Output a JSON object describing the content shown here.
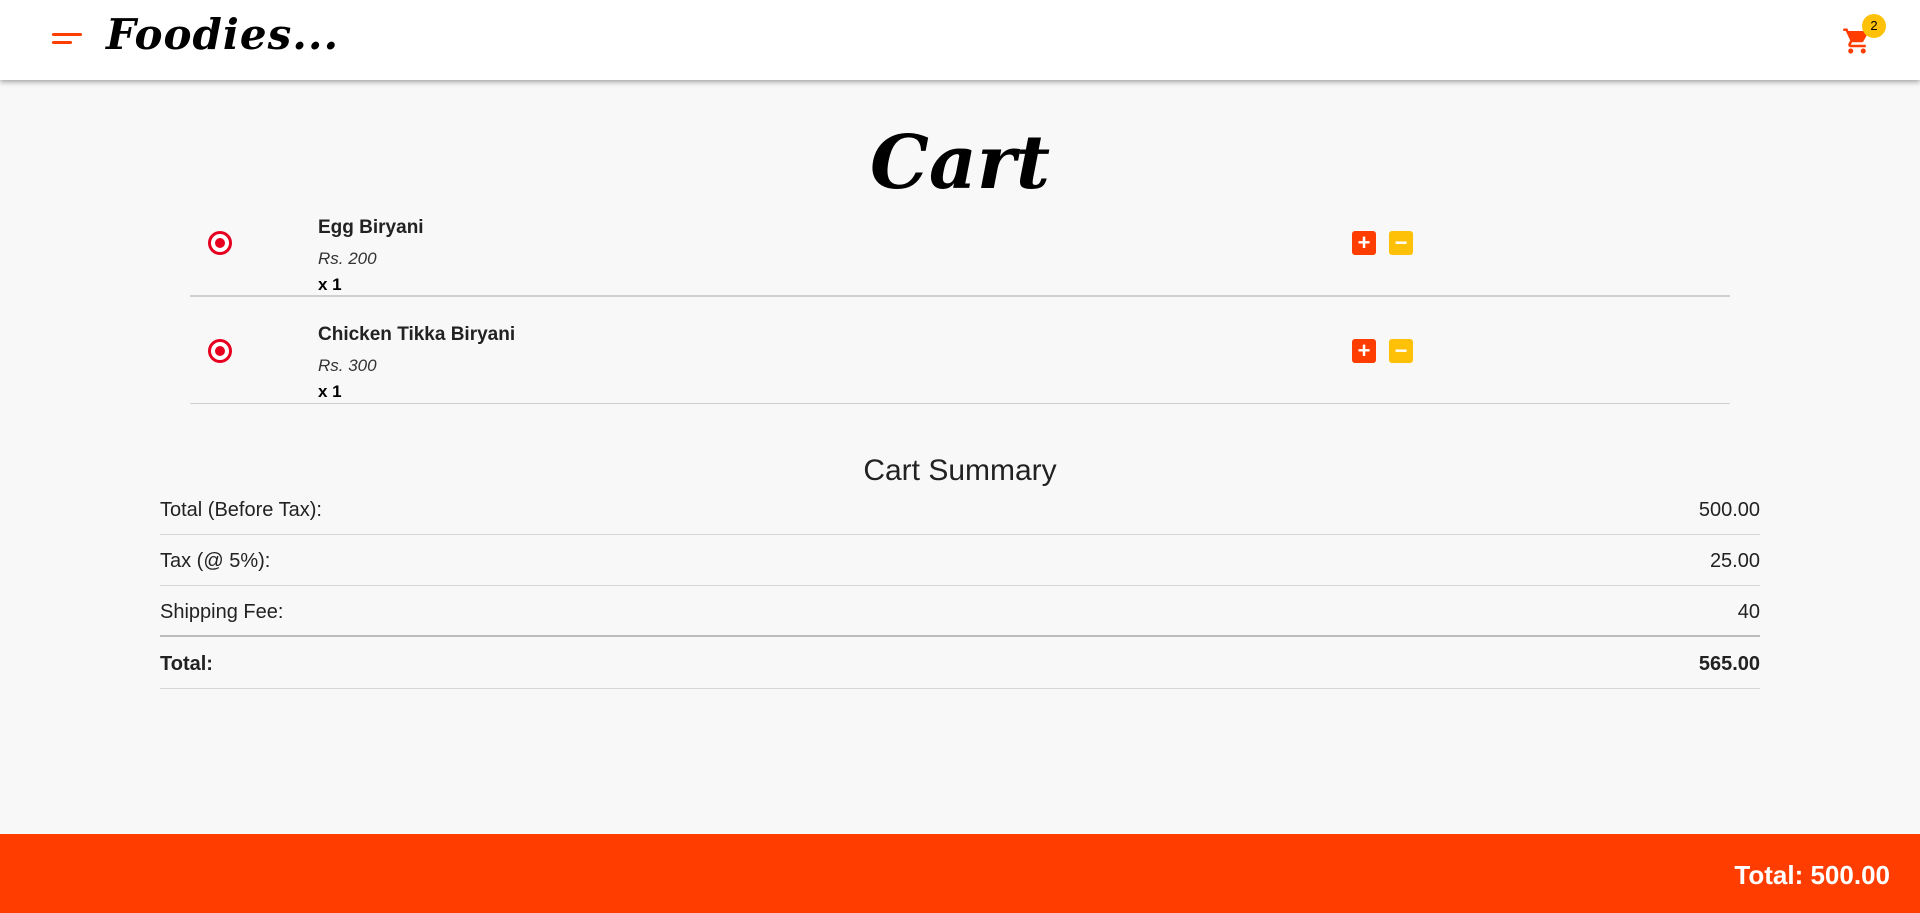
{
  "header": {
    "brand": "Foodies...",
    "cart_count": "2",
    "menu_icon": "menu-icon",
    "cart_icon": "cart-icon"
  },
  "page": {
    "title": "Cart"
  },
  "items": [
    {
      "name": "Egg Biryani",
      "price": "Rs. 200",
      "qty": "x 1",
      "plus": "+",
      "minus": "−"
    },
    {
      "name": "Chicken Tikka Biryani",
      "price": "Rs. 300",
      "qty": "x 1",
      "plus": "+",
      "minus": "−"
    }
  ],
  "summary": {
    "title": "Cart Summary",
    "rows": [
      {
        "label": "Total (Before Tax):",
        "value": "500.00"
      },
      {
        "label": "Tax (@ 5%):",
        "value": "25.00"
      },
      {
        "label": "Shipping Fee:",
        "value": "40"
      },
      {
        "label": "Total:",
        "value": "565.00"
      }
    ]
  },
  "footer": {
    "total": "Total: 500.00"
  },
  "colors": {
    "accent": "#ff3d00",
    "secondary": "#ffc107",
    "radio": "#e8001f"
  }
}
